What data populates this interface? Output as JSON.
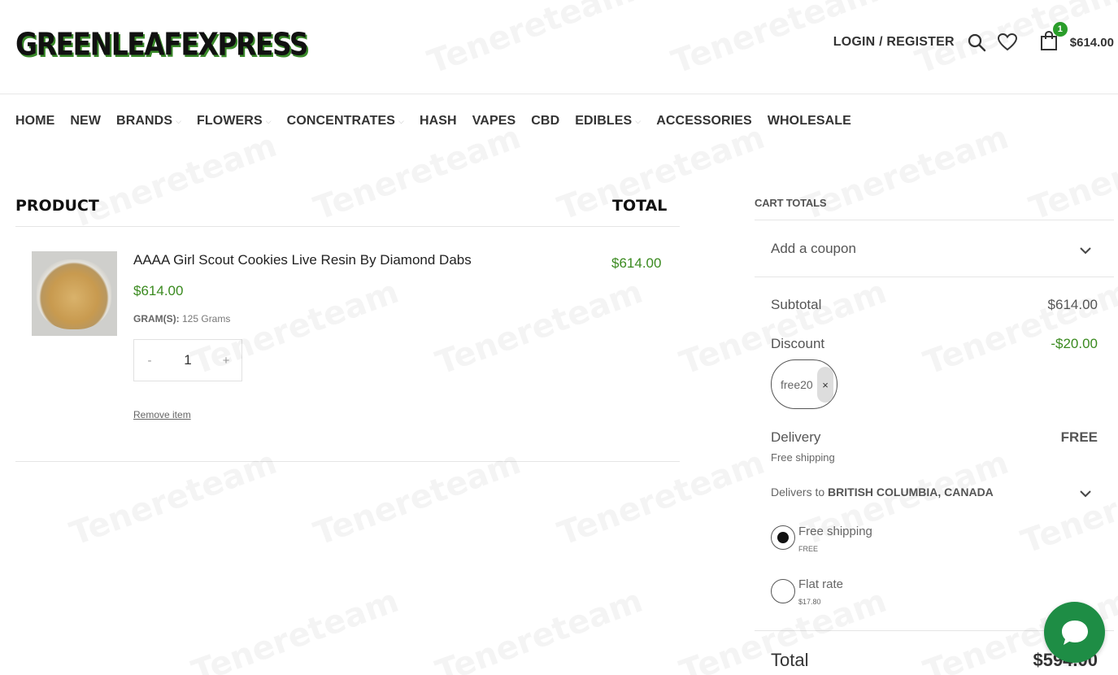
{
  "brand": {
    "logo_text": "GREENLEAFEXPRESS"
  },
  "header": {
    "login_label": "LOGIN / REGISTER",
    "cart_count": "1",
    "cart_amount": "$614.00"
  },
  "nav": {
    "items": [
      {
        "label": "HOME",
        "has_dropdown": false
      },
      {
        "label": "NEW",
        "has_dropdown": false
      },
      {
        "label": "BRANDS",
        "has_dropdown": true
      },
      {
        "label": "FLOWERS",
        "has_dropdown": true
      },
      {
        "label": "CONCENTRATES",
        "has_dropdown": true
      },
      {
        "label": "HASH",
        "has_dropdown": false
      },
      {
        "label": "VAPES",
        "has_dropdown": false
      },
      {
        "label": "CBD",
        "has_dropdown": false
      },
      {
        "label": "EDIBLES",
        "has_dropdown": true
      },
      {
        "label": "ACCESSORIES",
        "has_dropdown": false
      },
      {
        "label": "WHOLESALE",
        "has_dropdown": false
      }
    ]
  },
  "cart_table": {
    "col_product": "PRODUCT",
    "col_total": "TOTAL",
    "item": {
      "name": "AAAA Girl Scout Cookies Live Resin By Diamond Dabs",
      "price": "$614.00",
      "meta_label": "GRAM(S):",
      "meta_value": "125 Grams",
      "qty_minus": "-",
      "qty": "1",
      "qty_plus": "+",
      "remove_label": "Remove item",
      "row_total": "$614.00"
    }
  },
  "cart_totals": {
    "title": "CART TOTALS",
    "coupon_label": "Add a coupon",
    "subtotal_label": "Subtotal",
    "subtotal_value": "$614.00",
    "discount_label": "Discount",
    "discount_value": "-$20.00",
    "coupon_code": "free20",
    "coupon_remove": "×",
    "delivery_label": "Delivery",
    "delivery_value": "FREE",
    "delivery_sub": "Free shipping",
    "delivers_to_prefix": "Delivers to",
    "delivers_to_place": "BRITISH COLUMBIA, CANADA",
    "options": [
      {
        "label": "Free shipping",
        "price": "FREE",
        "selected": true
      },
      {
        "label": "Flat rate",
        "price": "$17.80",
        "selected": false
      }
    ],
    "total_label": "Total",
    "total_value": "$594.00"
  },
  "watermark": {
    "text": "Tenereteam"
  },
  "colors": {
    "accent_green": "#3a8a1f",
    "badge_green": "#2a9d2a",
    "chat_green": "#1e8d45"
  }
}
